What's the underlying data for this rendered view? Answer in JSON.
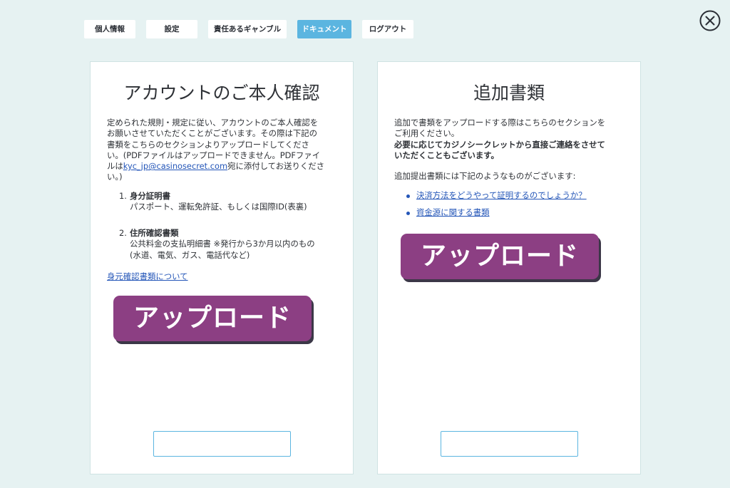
{
  "nav": {
    "tabs": [
      {
        "label": "個人情報",
        "active": false
      },
      {
        "label": "設定",
        "active": false
      },
      {
        "label": "責任あるギャンブル",
        "active": false
      },
      {
        "label": "ドキュメント",
        "active": true
      },
      {
        "label": "ログアウト",
        "active": false
      }
    ],
    "close_icon": "circle-x-icon"
  },
  "colors": {
    "background": "#e6f2f2",
    "active_tab": "#5bb5e0",
    "upload_button": "#8c3f83",
    "link": "#2456b8"
  },
  "left": {
    "title": "アカウントのご本人確認",
    "intro_lines": [
      "定められた規則・規定に従い、アカウントのご本人確認を",
      "お願いさせていただくことがございます。その際は下記の",
      "書類をこちらのセクションよりアップロードしてくださ",
      "い。(PDFファイルはアップロードできません。PDFファイ"
    ],
    "email_prefix": "ルは",
    "email": "kyc_jp@casinosecret.com",
    "email_suffix": "宛に添付してお送りくださ",
    "intro_end": "い。)",
    "items": [
      {
        "number": "1.",
        "heading": "身分証明書",
        "lines": [
          "パスポート、運転免許証、もしくは国際ID(表裏)"
        ]
      },
      {
        "number": "2.",
        "heading": "住所確認書類",
        "lines": [
          "公共料金の支払明細書 ※発行から3か月以内のもの",
          "(水道、電気、ガス、電話代など)"
        ]
      }
    ],
    "link": "身元確認書類について",
    "upload_label": "アップロード"
  },
  "right": {
    "title": "追加書類",
    "intro_lines": [
      "追加で書類をアップロードする際はこちらのセクションを",
      "ご利用ください。"
    ],
    "bold_lines": [
      "必要に応じてカジノシークレットから直接ご連絡をさせて",
      "いただくこともございます。"
    ],
    "list_intro": "追加提出書類には下記のようなものがございます:",
    "links": [
      "決済方法をどうやって証明するのでしょうか？",
      "資金源に関する書類"
    ],
    "upload_label": "アップロード"
  }
}
